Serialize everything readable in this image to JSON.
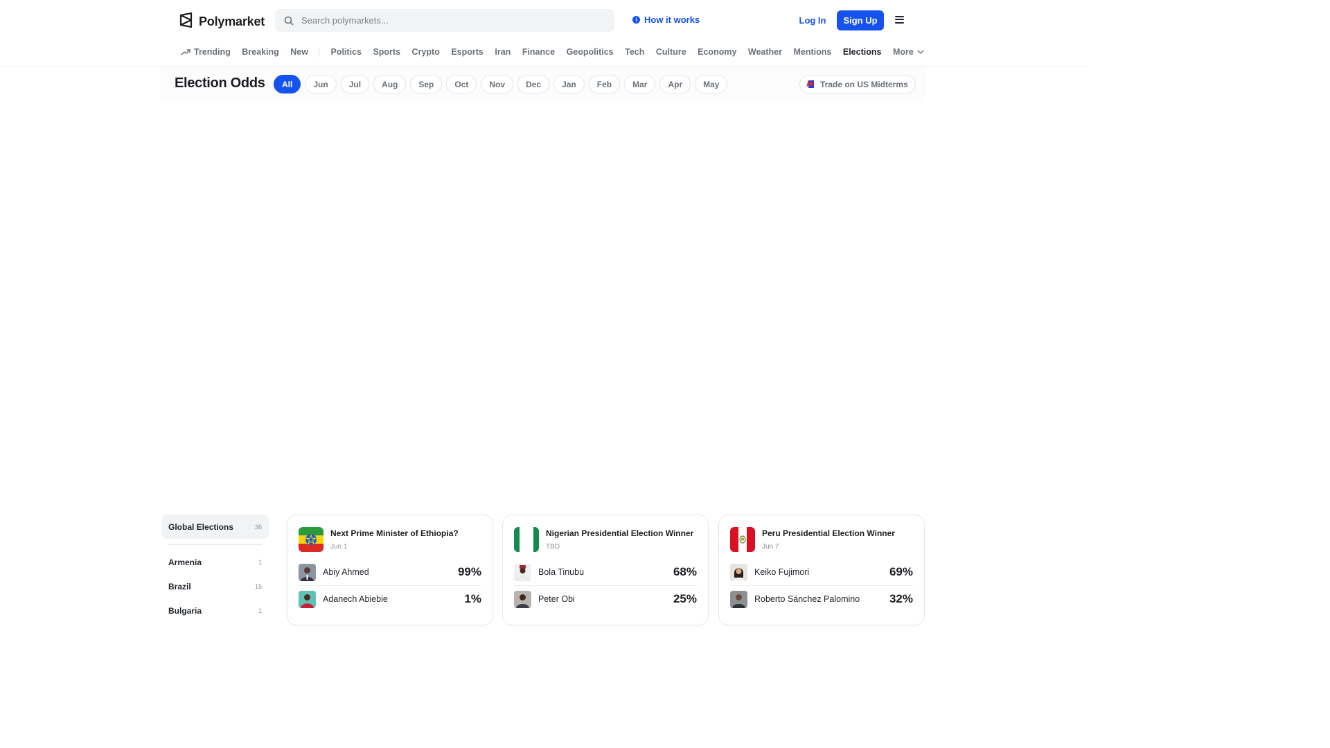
{
  "brand": {
    "name": "Polymarket"
  },
  "search": {
    "placeholder": "Search polymarkets..."
  },
  "header": {
    "how_it_works": "How it works",
    "login": "Log In",
    "signup": "Sign Up"
  },
  "nav": {
    "items": [
      "Trending",
      "Breaking",
      "New",
      "Politics",
      "Sports",
      "Crypto",
      "Esports",
      "Iran",
      "Finance",
      "Geopolitics",
      "Tech",
      "Culture",
      "Economy",
      "Weather",
      "Mentions",
      "Elections",
      "More"
    ],
    "active": "Elections"
  },
  "page": {
    "title": "Election Odds",
    "months": [
      "All",
      "Jun",
      "Jul",
      "Aug",
      "Sep",
      "Oct",
      "Nov",
      "Dec",
      "Jan",
      "Feb",
      "Mar",
      "Apr",
      "May"
    ],
    "active_month": "All",
    "midterms_link": "Trade on US Midterms"
  },
  "sidebar": {
    "items": [
      {
        "label": "Global Elections",
        "count": "36"
      },
      {
        "label": "Armenia",
        "count": "1"
      },
      {
        "label": "Brazil",
        "count": "15"
      },
      {
        "label": "Bulgaria",
        "count": "1"
      }
    ]
  },
  "cards": [
    {
      "title": "Next Prime Minister of Ethiopia?",
      "date": "Jun 1",
      "flag": "ethiopia-flag",
      "candidates": [
        {
          "name": "Abiy Ahmed",
          "pct": "99%"
        },
        {
          "name": "Adanech Abiebie",
          "pct": "1%"
        }
      ]
    },
    {
      "title": "Nigerian Presidential Election Winner",
      "date": "TBD",
      "flag": "nigeria-flag",
      "candidates": [
        {
          "name": "Bola Tinubu",
          "pct": "68%"
        },
        {
          "name": "Peter Obi",
          "pct": "25%"
        }
      ]
    },
    {
      "title": "Peru Presidential Election Winner",
      "date": "Jun 7",
      "flag": "peru-flag",
      "candidates": [
        {
          "name": "Keiko Fujimori",
          "pct": "69%"
        },
        {
          "name": "Roberto Sánchez Palomino",
          "pct": "32%"
        }
      ]
    }
  ],
  "colors": {
    "accent": "#1652f0",
    "text": "#1f2329",
    "muted": "#6b7178"
  }
}
